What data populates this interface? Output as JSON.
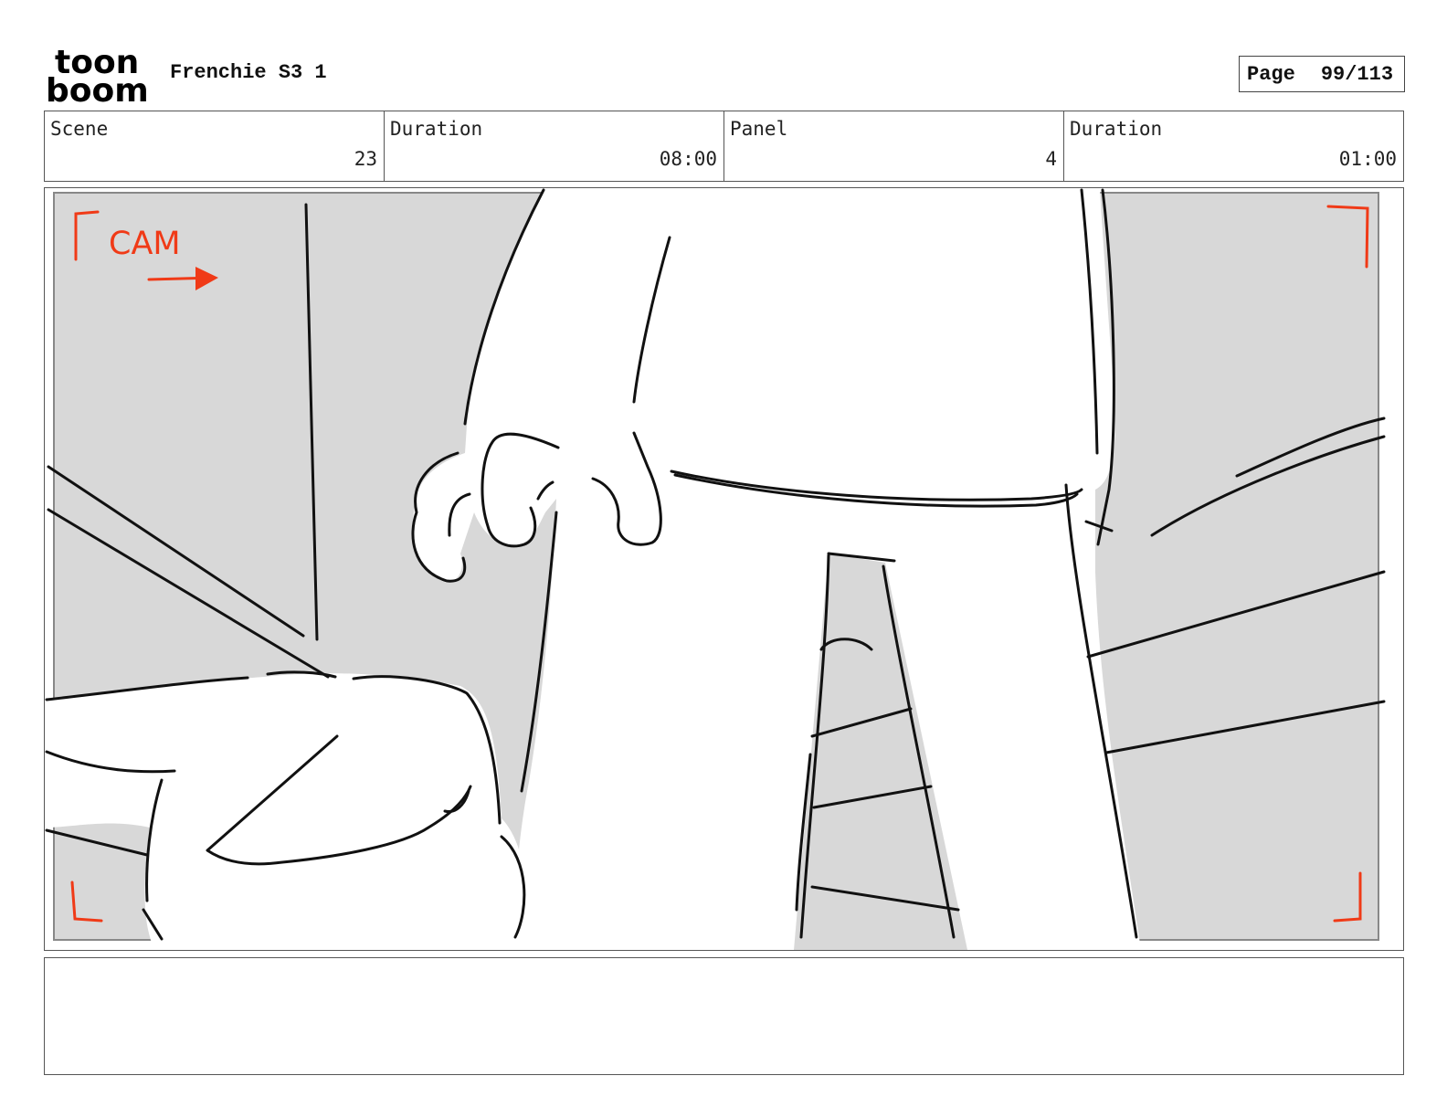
{
  "header": {
    "logo_line1": "toon",
    "logo_line2": "boom",
    "project_title": "Frenchie S3 1",
    "page_label": "Page",
    "page_number": "99/113"
  },
  "info": {
    "scene_label": "Scene",
    "scene_value": "23",
    "scene_duration_label": "Duration",
    "scene_duration_value": "08:00",
    "panel_label": "Panel",
    "panel_value": "4",
    "panel_duration_label": "Duration",
    "panel_duration_value": "01:00"
  },
  "panel": {
    "cam_annotation": "CAM",
    "annotation_color": "#f03a17",
    "background_fill": "#d8d8d8"
  },
  "notes": {
    "text": ""
  }
}
